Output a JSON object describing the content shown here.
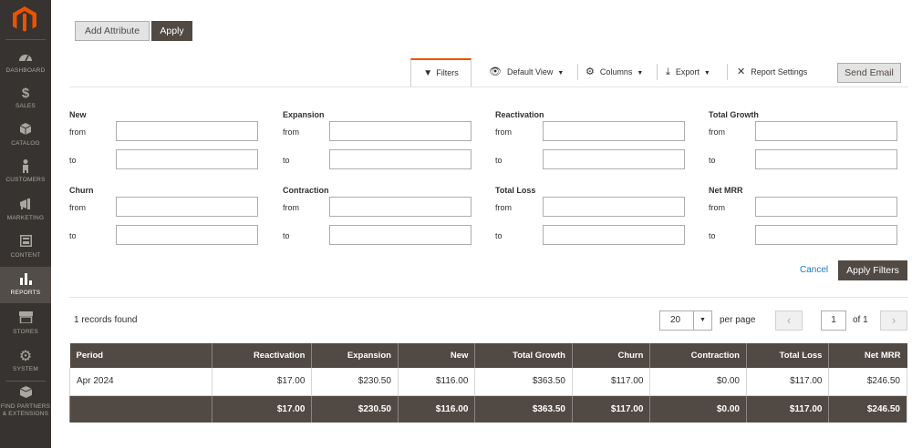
{
  "sidebar": {
    "items": [
      {
        "label": "DASHBOARD",
        "icon": "gauge-icon"
      },
      {
        "label": "SALES",
        "icon": "dollar-icon"
      },
      {
        "label": "CATALOG",
        "icon": "cube-icon"
      },
      {
        "label": "CUSTOMERS",
        "icon": "person-icon"
      },
      {
        "label": "MARKETING",
        "icon": "megaphone-icon"
      },
      {
        "label": "CONTENT",
        "icon": "layout-icon"
      },
      {
        "label": "REPORTS",
        "icon": "bar-chart-icon"
      },
      {
        "label": "STORES",
        "icon": "storefront-icon"
      },
      {
        "label": "SYSTEM",
        "icon": "gear-icon"
      },
      {
        "label": "FIND PARTNERS",
        "label2": "& EXTENSIONS",
        "icon": "box-icon"
      }
    ],
    "active": "REPORTS",
    "accent": "#eb5202"
  },
  "actions": {
    "add_attribute": "Add Attribute",
    "apply": "Apply"
  },
  "toolbar": {
    "filters": "Filters",
    "default_view": "Default View",
    "columns": "Columns",
    "export": "Export",
    "report_settings": "Report Settings",
    "send_email": "Send Email"
  },
  "filters": {
    "from_label": "from",
    "to_label": "to",
    "groups": [
      "New",
      "Expansion",
      "Reactivation",
      "Total Growth",
      "Churn",
      "Contraction",
      "Total Loss",
      "Net MRR"
    ],
    "cancel": "Cancel",
    "apply_filters": "Apply Filters"
  },
  "grid": {
    "records_found": "1 records found",
    "per_page_value": "20",
    "per_page_label": "per page",
    "page_value": "1",
    "page_of": "of 1",
    "columns": [
      "Period",
      "Reactivation",
      "Expansion",
      "New",
      "Total Growth",
      "Churn",
      "Contraction",
      "Total Loss",
      "Net MRR"
    ],
    "rows": [
      [
        "Apr 2024",
        "$17.00",
        "$230.50",
        "$116.00",
        "$363.50",
        "$117.00",
        "$0.00",
        "$117.00",
        "$246.50"
      ]
    ],
    "totals": [
      "",
      "$17.00",
      "$230.50",
      "$116.00",
      "$363.50",
      "$117.00",
      "$0.00",
      "$117.00",
      "$246.50"
    ]
  }
}
